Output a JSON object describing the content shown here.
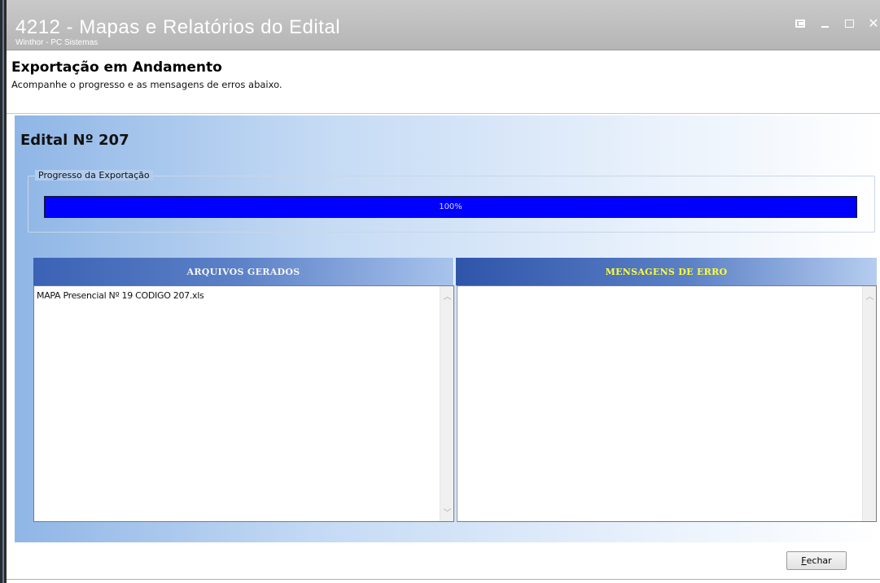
{
  "window": {
    "title": "4212 - Mapas e Relatórios do Edital",
    "subtitle": "Winthor - PC Sistemas"
  },
  "header": {
    "title": "Exportação em Andamento",
    "subtitle": "Acompanhe o progresso e as mensagens de erros abaixo."
  },
  "edital": {
    "title": "Edital Nº 207"
  },
  "progress": {
    "group_label": "Progresso da Exportação",
    "value_label": "100%",
    "value": 1.0
  },
  "files": {
    "header": "ARQUIVOS GERADOS",
    "items": [
      "MAPA Presencial Nº 19 CODIGO 207.xls"
    ]
  },
  "errors": {
    "header": "MENSAGENS DE ERRO",
    "items": []
  },
  "footer": {
    "close_label_first": "F",
    "close_label_rest": "echar"
  },
  "colors": {
    "progress_fill": "#0000ff",
    "error_header_text": "#ffff33",
    "panel_gradient_start": "#8fb6e6"
  }
}
